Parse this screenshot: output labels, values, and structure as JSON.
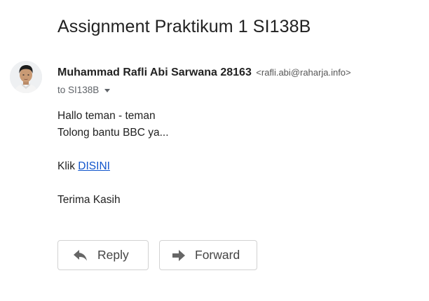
{
  "email": {
    "subject": "Assignment Praktikum 1 SI138B",
    "sender": {
      "name": "Muhammad Rafli Abi Sarwana 28163",
      "email": "<rafli.abi@raharja.info>"
    },
    "recipient_line": "to SI138B",
    "body": {
      "line1": "Hallo teman - teman",
      "line2": "Tolong bantu BBC ya...",
      "klik_label": "Klik",
      "link_text": "DISINI",
      "closing": "Terima Kasih"
    }
  },
  "actions": {
    "reply_label": "Reply",
    "forward_label": "Forward"
  },
  "icons": {
    "reply": "reply-arrow-icon",
    "forward": "forward-arrow-icon",
    "recipient_details": "chevron-down-icon"
  },
  "colors": {
    "link": "#1155cc",
    "text": "#222222",
    "muted": "#5f6368"
  }
}
